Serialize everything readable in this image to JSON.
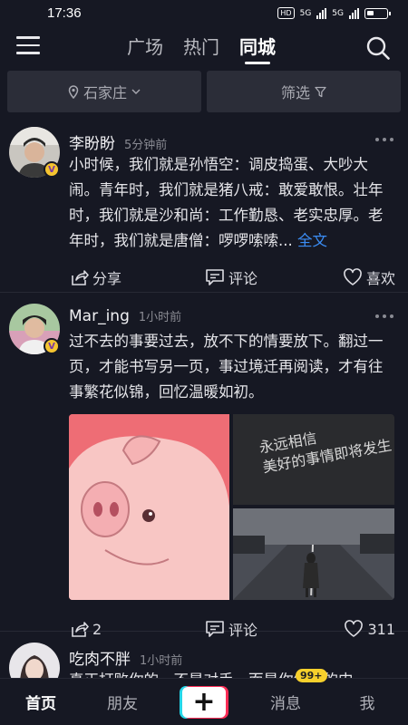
{
  "status": {
    "time": "17:36",
    "hd": "HD",
    "net1": "5G",
    "net2": "5G"
  },
  "top_nav": {
    "tabs": [
      "广场",
      "热门",
      "同城"
    ],
    "active_index": 2
  },
  "filters": {
    "city": "石家庄",
    "filter_label": "筛选"
  },
  "posts": [
    {
      "author": "李盼盼",
      "time": "5分钟前",
      "text": "小时候，我们就是孙悟空：调皮捣蛋、大吵大闹。青年时，我们就是猪八戒：敢爱敢恨。壮年时，我们就是沙和尚：工作勤恳、老实忠厚。老年时，我们就是唐僧：啰啰嗦嗦...",
      "full_link": "全文",
      "share": "分享",
      "comment": "评论",
      "like": "喜欢"
    },
    {
      "author": "Mar_ing",
      "time": "1小时前",
      "text": "过不去的事要过去，放不下的情要放下。翻过一页，才能书写另一页，事过境迁再阅读，才有往事繁花似锦，回忆温暖如初。",
      "image_caption": "永远相信\n美好的事情即将发生",
      "share": "2",
      "comment": "评论",
      "like": "311"
    },
    {
      "author": "吃肉不胖",
      "time": "1小时前",
      "text": "真正打败你的，不是对手，而是你绝望的内"
    }
  ],
  "bottom_nav": {
    "home": "首页",
    "friends": "朋友",
    "messages": "消息",
    "me": "我",
    "message_badge": "99+"
  },
  "colors": {
    "background": "#161823",
    "link": "#3b8df5",
    "badge": "#f7d02c",
    "plus_cyan": "#24d6e8",
    "plus_red": "#fc2c55"
  }
}
